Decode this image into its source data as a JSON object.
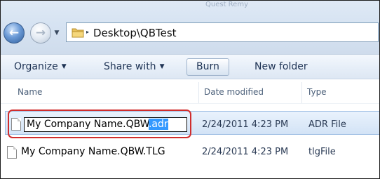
{
  "window": {
    "ghost_title": "Quest Remy"
  },
  "address_bar": {
    "path": "Desktop\\QBTest"
  },
  "toolbar": {
    "organize": "Organize",
    "share_with": "Share with",
    "burn": "Burn",
    "new_folder": "New folder"
  },
  "columns": {
    "name": "Name",
    "date_modified": "Date modified",
    "type": "Type"
  },
  "files": [
    {
      "name_base": "My Company Name.QBW",
      "name_selected_ext": ".adr",
      "date_modified": "2/24/2011 4:23 PM",
      "type": "ADR File",
      "state": "renaming"
    },
    {
      "name": "My Company Name.QBW.TLG",
      "date_modified": "2/24/2011 4:23 PM",
      "type": "tlgFile"
    }
  ],
  "colors": {
    "highlight_ring": "#d02d2d",
    "selection": "#3399ff",
    "row_selected": "#d3e3f6"
  }
}
